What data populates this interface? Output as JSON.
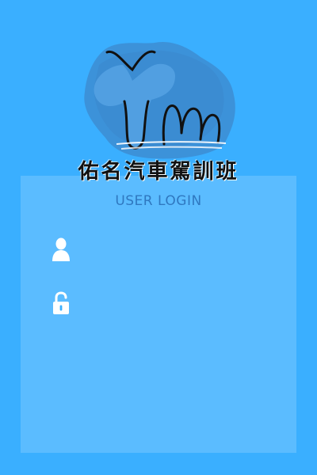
{
  "app": {
    "logo_text": "Ym",
    "brand_title": "佑名汽車駕訓班"
  },
  "login": {
    "heading": "USER LOGIN",
    "username": {
      "icon": "user-icon",
      "value": "",
      "placeholder": ""
    },
    "password": {
      "icon": "lock-icon",
      "value": "",
      "placeholder": ""
    }
  },
  "colors": {
    "background": "#3aafff",
    "panel": "rgba(255,255,255,0.17)",
    "logo_blot": "#3d8fd6",
    "heading": "#2f78c0",
    "icon": "#ffffff"
  }
}
